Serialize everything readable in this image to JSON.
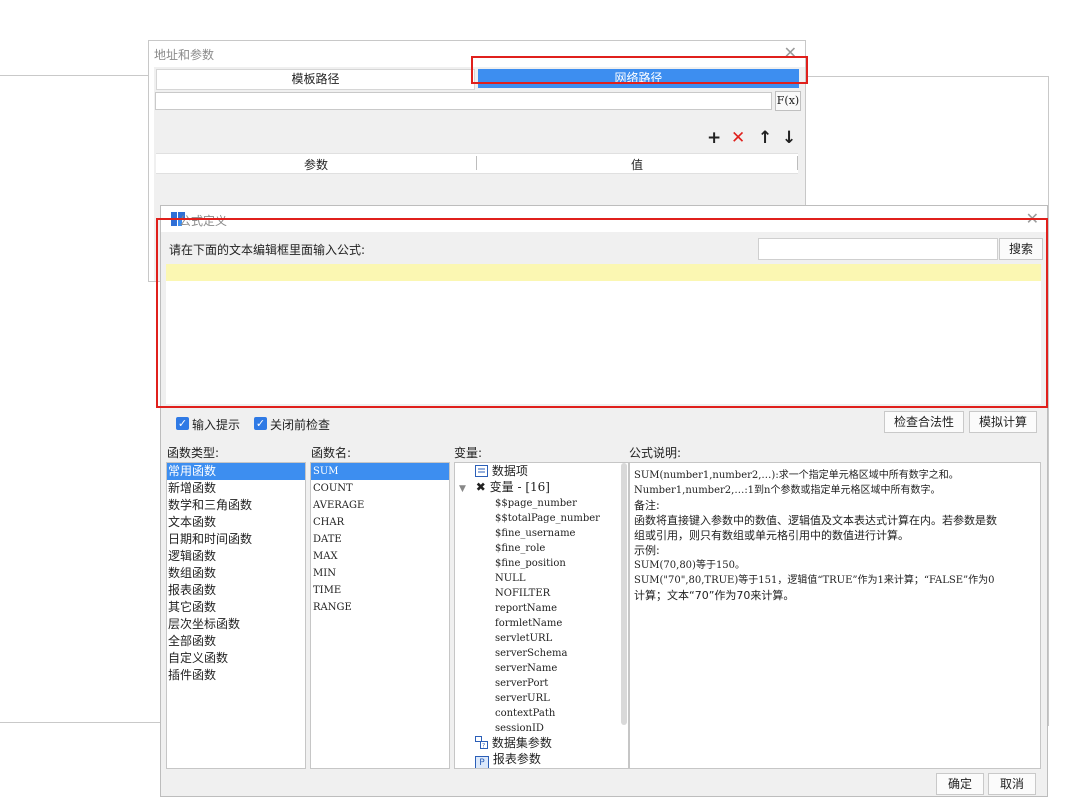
{
  "back_dialog": {
    "title": "地址和参数",
    "close": "✕",
    "tabs": [
      {
        "label": "模板路径",
        "selected": false
      },
      {
        "label": "网络路径",
        "selected": true
      }
    ],
    "path_value": "",
    "fx_label": "F(x)",
    "toolbar": {
      "add": "+",
      "remove": "✕",
      "up": "↑",
      "down": "↓"
    },
    "columns": [
      "参数",
      "值"
    ]
  },
  "formula_dialog": {
    "title": "公式定义",
    "close": "✕",
    "prompt": "请在下面的文本编辑框里面输入公式:",
    "search_value": "",
    "search_button": "搜索",
    "formula_text": "",
    "options": [
      {
        "label": "输入提示",
        "checked": true
      },
      {
        "label": "关闭前检查",
        "checked": true
      }
    ],
    "check_button": "检查合法性",
    "simulate_button": "模拟计算",
    "headers": {
      "function_types": "函数类型:",
      "function_names": "函数名:",
      "variables": "变量:",
      "description": "公式说明:"
    },
    "function_types": [
      "常用函数",
      "新增函数",
      "数学和三角函数",
      "文本函数",
      "日期和时间函数",
      "逻辑函数",
      "数组函数",
      "报表函数",
      "其它函数",
      "层次坐标函数",
      "全部函数",
      "自定义函数",
      "插件函数"
    ],
    "selected_type_index": 0,
    "function_names": [
      "SUM",
      "COUNT",
      "AVERAGE",
      "CHAR",
      "DATE",
      "MAX",
      "MIN",
      "TIME",
      "RANGE"
    ],
    "selected_function_index": 0,
    "variables": {
      "data_item": "数据项",
      "group_label": "变量 - [16]",
      "items": [
        "$$page_number",
        "$$totalPage_number",
        "$fine_username",
        "$fine_role",
        "$fine_position",
        "NULL",
        "NOFILTER",
        "reportName",
        "formletName",
        "servletURL",
        "serverSchema",
        "serverName",
        "serverPort",
        "serverURL",
        "contextPath",
        "sessionID"
      ],
      "dataset_params": "数据集参数",
      "report_params": "报表参数"
    },
    "description_lines": [
      "SUM(number1,number2,…):求一个指定单元格区域中所有数字之和。",
      "Number1,number2,…:1到n个参数或指定单元格区域中所有数字。",
      "备注:",
      "函数将直接键入参数中的数值、逻辑值及文本表达式计算在内。若参数是数",
      "组或引用，则只有数组或单元格引用中的数值进行计算。",
      "示例:",
      "SUM(70,80)等于150。",
      "SUM(\"70\",80,TRUE)等于151，逻辑值“TRUE”作为1来计算；“FALSE”作为0",
      "计算；文本“70”作为70来计算。"
    ],
    "ok_button": "确定",
    "cancel_button": "取消"
  },
  "colors": {
    "accent": "#3d8ef0",
    "highlight_box": "#e0201c",
    "formula_line": "#fbf7b2",
    "delete_icon": "#e0201c"
  }
}
